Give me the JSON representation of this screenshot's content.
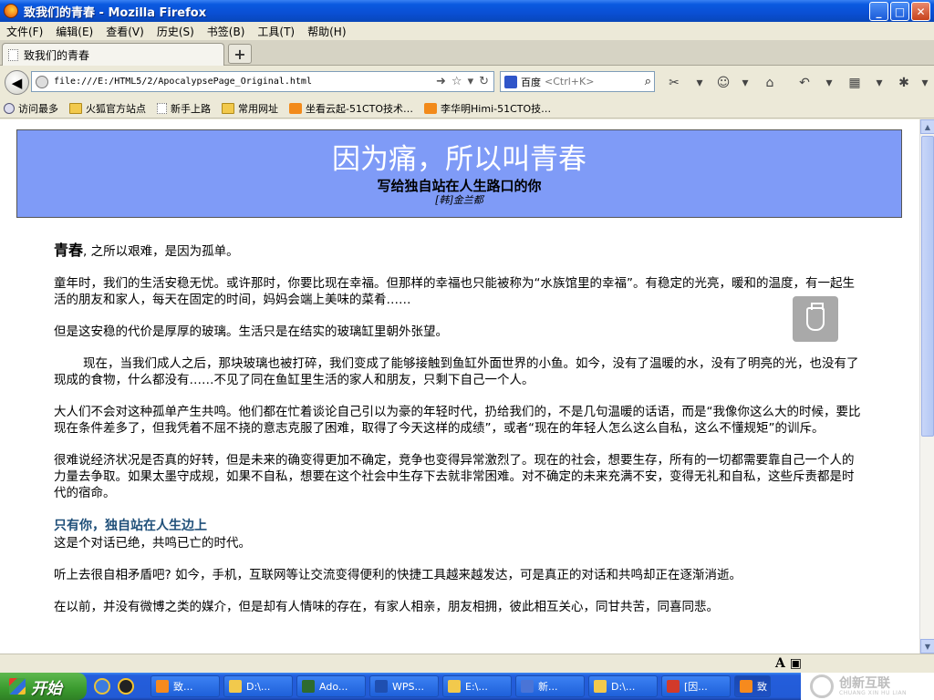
{
  "window": {
    "title": "致我们的青春 - Mozilla Firefox",
    "buttons": {
      "minimize": "_",
      "maximize": "□",
      "close": "✕"
    }
  },
  "menubar": [
    "文件(F)",
    "编辑(E)",
    "查看(V)",
    "历史(S)",
    "书签(B)",
    "工具(T)",
    "帮助(H)"
  ],
  "tabs": [
    {
      "label": "致我们的青春"
    }
  ],
  "newtab_label": "+",
  "navbar": {
    "url": "file:///E:/HTML5/2/ApocalypsePage_Original.html",
    "search_engine": "百度",
    "search_placeholder": "<Ctrl+K>"
  },
  "bookmarks": [
    {
      "label": "访问最多",
      "icon": "mag"
    },
    {
      "label": "火狐官方站点",
      "icon": "folder"
    },
    {
      "label": "新手上路",
      "icon": "page"
    },
    {
      "label": "常用网址",
      "icon": "folder"
    },
    {
      "label": "坐看云起-51CTO技术…",
      "icon": "rss"
    },
    {
      "label": "李华明Himi-51CTO技…",
      "icon": "rss"
    }
  ],
  "page": {
    "header_title": "因为痛，所以叫青春",
    "header_subtitle": "写给独自站在人生路口的你",
    "header_author": "[韩]金兰都",
    "p1_lead": "青春",
    "p1_rest": ", 之所以艰难，是因为孤单。",
    "p2": "童年时，我们的生活安稳无忧。或许那时，你要比现在幸福。但那样的幸福也只能被称为“水族馆里的幸福”。有稳定的光亮，暖和的温度，有一起生活的朋友和家人，每天在固定的时间，妈妈会端上美味的菜肴……",
    "p3": "但是这安稳的代价是厚厚的玻璃。生活只是在结实的玻璃缸里朝外张望。",
    "p4": "现在，当我们成人之后，那块玻璃也被打碎，我们变成了能够接触到鱼缸外面世界的小鱼。如今，没有了温暖的水，没有了明亮的光，也没有了现成的食物，什么都没有……不见了同在鱼缸里生活的家人和朋友，只剩下自己一个人。",
    "p5": "大人们不会对这种孤单产生共鸣。他们都在忙着谈论自己引以为豪的年轻时代，扔给我们的，不是几句温暖的话语，而是“我像你这么大的时候，要比现在条件差多了，但我凭着不屈不挠的意志克服了困难，取得了今天这样的成绩”，或者“现在的年轻人怎么这么自私，这么不懂规矩”的训斥。",
    "p6": "很难说经济状况是否真的好转，但是未来的确变得更加不确定，竞争也变得异常激烈了。现在的社会，想要生存，所有的一切都需要靠自己一个人的力量去争取。如果太墨守成规，如果不自私，想要在这个社会中生存下去就非常困难。对不确定的未来充满不安，变得无礼和自私，这些斥责都是时代的宿命。",
    "subhead": "只有你，独自站在人生边上",
    "p7": "这是个对话已绝，共鸣已亡的时代。",
    "p8": "听上去很自相矛盾吧? 如今，手机，互联网等让交流变得便利的快捷工具越来越发达，可是真正的对话和共鸣却正在逐渐消逝。",
    "p9": "在以前，并没有微博之类的媒介，但是却有人情味的存在，有家人相亲，朋友相拥，彼此相互关心，同甘共苦，同喜同悲。"
  },
  "statusbar": {
    "icons_text": "A ▣"
  },
  "taskbar": {
    "start_label": "开始",
    "items": [
      {
        "label": "致...",
        "color": "#f68a1e",
        "active": false
      },
      {
        "label": "D:\\...",
        "color": "#f2c94c",
        "active": false
      },
      {
        "label": "Ado...",
        "color": "#2e6b2e",
        "active": false
      },
      {
        "label": "WPS...",
        "color": "#1f4fb0",
        "active": false
      },
      {
        "label": "E:\\...",
        "color": "#f2c94c",
        "active": false
      },
      {
        "label": "新...",
        "color": "#4a74d6",
        "active": false
      },
      {
        "label": "D:\\...",
        "color": "#f2c94c",
        "active": false
      },
      {
        "label": "[因...",
        "color": "#d23a2a",
        "active": false
      },
      {
        "label": "致",
        "color": "#f68a1e",
        "active": true
      }
    ],
    "tray_brand": "创新互联",
    "tray_brand_sub": "CHUANG XIN HU LIAN"
  }
}
